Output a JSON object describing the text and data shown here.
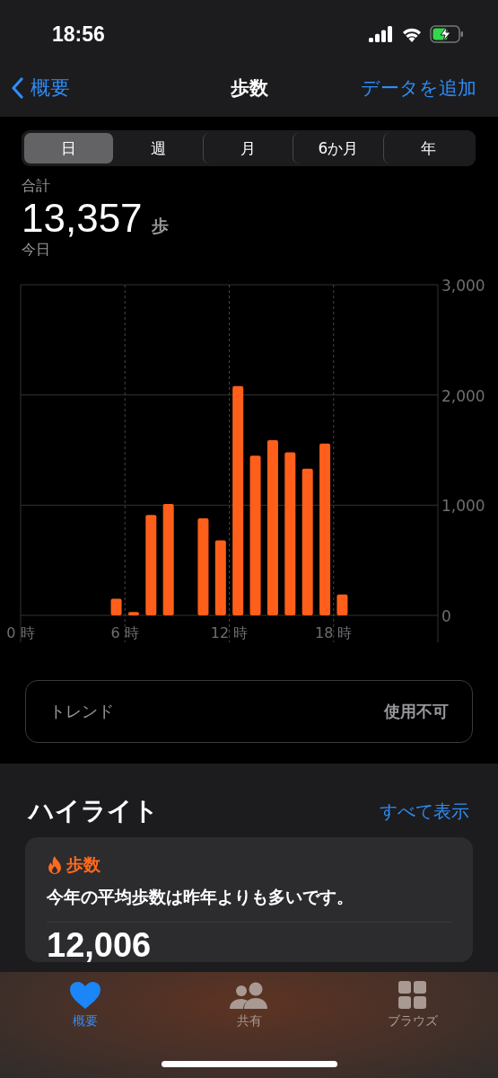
{
  "status_bar": {
    "time": "18:56"
  },
  "nav": {
    "back": "概要",
    "title": "歩数",
    "action": "データを追加"
  },
  "segments": [
    {
      "label": "日",
      "selected": true
    },
    {
      "label": "週",
      "selected": false
    },
    {
      "label": "月",
      "selected": false
    },
    {
      "label": "6か月",
      "selected": false
    },
    {
      "label": "年",
      "selected": false
    }
  ],
  "summary": {
    "label": "合計",
    "value": "13,357",
    "unit": "歩",
    "period": "今日"
  },
  "chart_data": {
    "type": "bar",
    "x": [
      5.5,
      6.5,
      7.5,
      8.5,
      10.5,
      11.5,
      12.5,
      13.5,
      14.5,
      15.5,
      16.5,
      17.5,
      18.5
    ],
    "xlim": [
      0,
      24
    ],
    "grid": true,
    "values": [
      150,
      30,
      910,
      1010,
      880,
      680,
      2080,
      1450,
      1590,
      1480,
      1330,
      1560,
      190
    ],
    "ylim": [
      0,
      3000
    ],
    "yticks": [
      {
        "value": 0,
        "label": "0"
      },
      {
        "value": 1000,
        "label": "1,000"
      },
      {
        "value": 2000,
        "label": "2,000"
      },
      {
        "value": 3000,
        "label": "3,000"
      }
    ],
    "xticks": [
      {
        "value": 0,
        "label": "0 時"
      },
      {
        "value": 6,
        "label": "6 時"
      },
      {
        "value": 12,
        "label": "12 時"
      },
      {
        "value": 18,
        "label": "18 時"
      }
    ]
  },
  "trend": {
    "label": "トレンド",
    "value": "使用不可"
  },
  "highlights": {
    "title": "ハイライト",
    "link": "すべて表示",
    "card": {
      "category": "歩数",
      "text": "今年の平均歩数は昨年よりも多いです。",
      "value": "12,006"
    }
  },
  "tab_bar": [
    {
      "kind": "heart",
      "label": "概要",
      "selected": true
    },
    {
      "kind": "people",
      "label": "共有",
      "selected": false
    },
    {
      "kind": "grid",
      "label": "ブラウズ",
      "selected": false
    }
  ]
}
